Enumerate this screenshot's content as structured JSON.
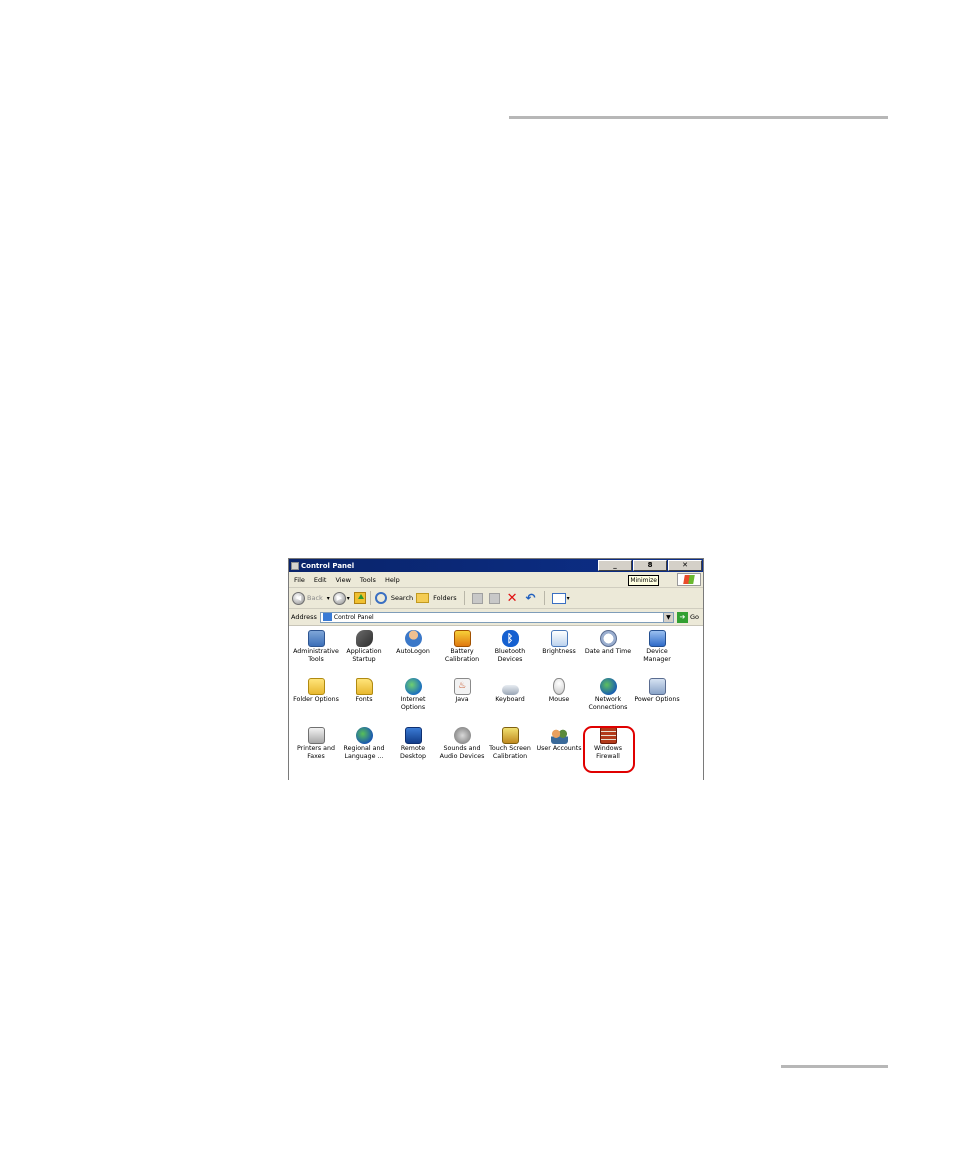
{
  "window": {
    "title": "Control Panel",
    "controls": {
      "minimize": "_",
      "restore": "8",
      "close": "✕"
    },
    "minimize_tooltip": "Minimize"
  },
  "menu": [
    "File",
    "Edit",
    "View",
    "Tools",
    "Help"
  ],
  "toolbar": {
    "back_label": "Back",
    "search_label": "Search",
    "folders_label": "Folders"
  },
  "address_bar": {
    "label": "Address",
    "value": "Control Panel",
    "go_label": "Go"
  },
  "items": [
    {
      "label": "Administrative Tools",
      "icon": "admin-tools-icon"
    },
    {
      "label": "Application Startup",
      "icon": "application-startup-icon"
    },
    {
      "label": "AutoLogon",
      "icon": "autologon-icon"
    },
    {
      "label": "Battery Calibration",
      "icon": "battery-calibration-icon"
    },
    {
      "label": "Bluetooth Devices",
      "icon": "bluetooth-icon"
    },
    {
      "label": "Brightness",
      "icon": "brightness-icon"
    },
    {
      "label": "Date and Time",
      "icon": "date-time-icon"
    },
    {
      "label": "Device Manager",
      "icon": "device-manager-icon"
    },
    {
      "label": "Folder Options",
      "icon": "folder-options-icon"
    },
    {
      "label": "Fonts",
      "icon": "fonts-icon"
    },
    {
      "label": "Internet Options",
      "icon": "internet-options-icon"
    },
    {
      "label": "Java",
      "icon": "java-icon"
    },
    {
      "label": "Keyboard",
      "icon": "keyboard-icon"
    },
    {
      "label": "Mouse",
      "icon": "mouse-icon"
    },
    {
      "label": "Network Connections",
      "icon": "network-connections-icon"
    },
    {
      "label": "Power Options",
      "icon": "power-options-icon"
    },
    {
      "label": "Printers and Faxes",
      "icon": "printers-faxes-icon"
    },
    {
      "label": "Regional and Language ...",
      "icon": "regional-language-icon"
    },
    {
      "label": "Remote Desktop",
      "icon": "remote-desktop-icon"
    },
    {
      "label": "Sounds and Audio Devices",
      "icon": "sounds-audio-icon"
    },
    {
      "label": "Touch Screen Calibration",
      "icon": "touch-screen-icon"
    },
    {
      "label": "User Accounts",
      "icon": "user-accounts-icon"
    },
    {
      "label": "Windows Firewall",
      "icon": "windows-firewall-icon"
    }
  ],
  "highlighted_item": "Windows Firewall",
  "colors": {
    "titlebar": "#0a246a",
    "highlight": "#e00000",
    "rule": "#b7b7b7"
  }
}
